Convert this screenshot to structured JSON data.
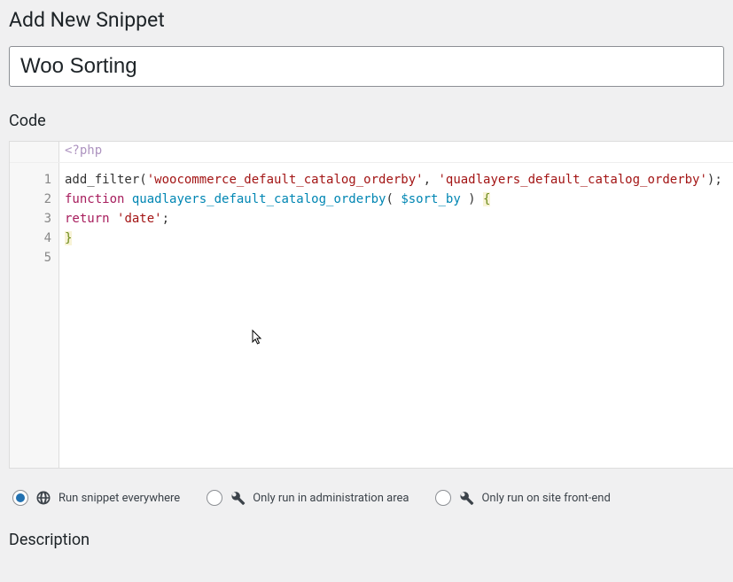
{
  "page": {
    "title": "Add New Snippet"
  },
  "snippet": {
    "title_value": "Woo Sorting"
  },
  "sections": {
    "code_heading": "Code",
    "description_heading": "Description"
  },
  "editor": {
    "php_open": "<?php",
    "lines": [
      "1",
      "2",
      "3",
      "4",
      "5"
    ],
    "code": {
      "l1": {
        "fn": "add_filter",
        "open": "(",
        "str1": "'woocommerce_default_catalog_orderby'",
        "comma": ", ",
        "str2": "'quadlayers_default_catalog_orderby'",
        "close": ");"
      },
      "l2": "",
      "l3": {
        "kw": "function",
        "sp1": " ",
        "name": "quadlayers_default_catalog_orderby",
        "open": "( ",
        "var": "$sort_by",
        "close": " ) ",
        "brace": "{"
      },
      "l4": {
        "kw": "return",
        "sp": " ",
        "str": "'date'",
        "semi": ";"
      },
      "l5": {
        "brace": "}"
      }
    }
  },
  "scope": {
    "options": [
      {
        "label": "Run snippet everywhere",
        "icon": "globe",
        "checked": true
      },
      {
        "label": "Only run in administration area",
        "icon": "wrench",
        "checked": false
      },
      {
        "label": "Only run on site front-end",
        "icon": "wrench",
        "checked": false
      }
    ]
  }
}
